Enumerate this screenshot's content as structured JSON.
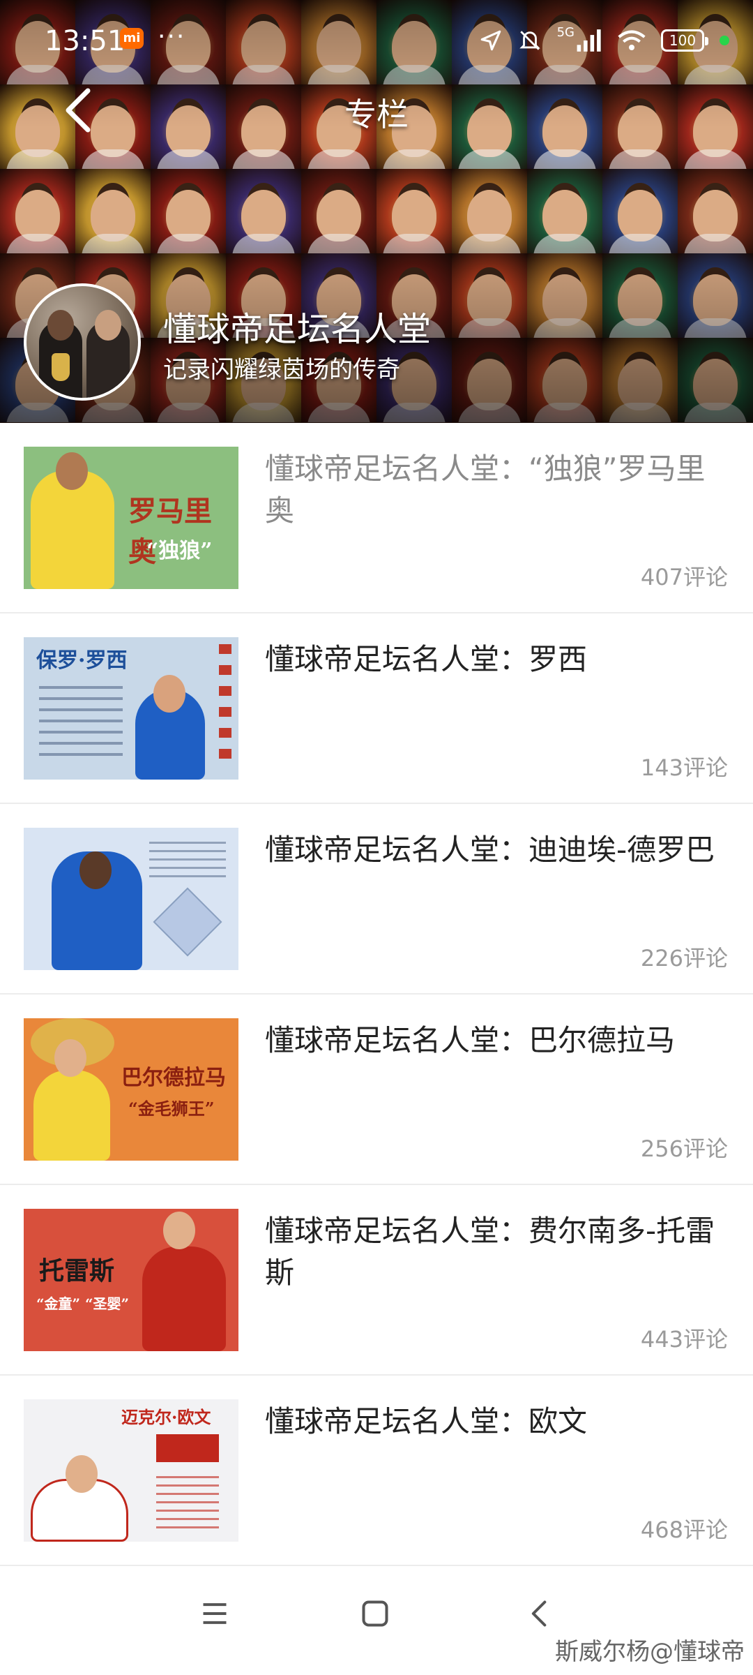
{
  "status_bar": {
    "time": "13:51",
    "carrier_badge": "mi",
    "dots": "···",
    "network": "5G",
    "battery": "100",
    "icons": [
      "location-icon",
      "mute-icon",
      "signal-icon",
      "wifi-icon",
      "battery-icon"
    ]
  },
  "nav": {
    "title": "专栏",
    "back_icon": "chevron-left-icon"
  },
  "column": {
    "title": "懂球帝足坛名人堂",
    "subtitle": "记录闪耀绿茵场的传奇"
  },
  "articles": [
    {
      "title": "懂球帝足坛名人堂：“独狼”罗马里奥",
      "comments": "407评论",
      "thumb_caption": "罗马里奥",
      "thumb_sub": "“独狼”"
    },
    {
      "title": "懂球帝足坛名人堂：罗西",
      "comments": "143评论",
      "thumb_caption": "保罗·罗西",
      "thumb_sub": ""
    },
    {
      "title": "懂球帝足坛名人堂：迪迪埃-德罗巴",
      "comments": "226评论",
      "thumb_caption": "",
      "thumb_sub": ""
    },
    {
      "title": "懂球帝足坛名人堂：巴尔德拉马",
      "comments": "256评论",
      "thumb_caption": "巴尔德拉马",
      "thumb_sub": "“金毛狮王”"
    },
    {
      "title": "懂球帝足坛名人堂：费尔南多-托雷斯",
      "comments": "443评论",
      "thumb_caption": "托雷斯",
      "thumb_sub": "“金童” “圣婴”"
    },
    {
      "title": "懂球帝足坛名人堂：欧文",
      "comments": "468评论",
      "thumb_caption": "迈克尔·欧文",
      "thumb_sub": ""
    }
  ],
  "system_nav": {
    "menu_icon": "menu-icon",
    "home_icon": "home-square-icon",
    "back_icon": "back-chevron-icon"
  },
  "watermark": "斯威尔杨@懂球帝",
  "colors": {
    "title_text": "#222222",
    "muted_text": "#8a8a8a",
    "comment_text": "#9a9a9a",
    "divider": "#ececec"
  }
}
